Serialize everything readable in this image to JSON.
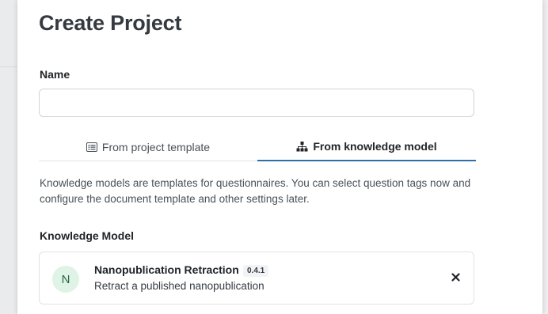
{
  "modal": {
    "title": "Create Project"
  },
  "form": {
    "name_label": "Name",
    "name_value": "",
    "name_placeholder": ""
  },
  "tabs": [
    {
      "label": "From project template",
      "icon": "list-icon",
      "active": false
    },
    {
      "label": "From knowledge model",
      "icon": "sitemap-icon",
      "active": true
    }
  ],
  "description": "Knowledge models are templates for questionnaires. You can select question tags now and configure the document template and other settings later.",
  "knowledge_model": {
    "section_label": "Knowledge Model",
    "selected": {
      "avatar_letter": "N",
      "name": "Nanopublication Retraction",
      "version": "0.4.1",
      "description": "Retract a published nanopublication"
    }
  },
  "colors": {
    "active_tab_underline": "#2f6fa8",
    "avatar_bg": "#dff3e6",
    "avatar_text": "#2d6a3f"
  }
}
